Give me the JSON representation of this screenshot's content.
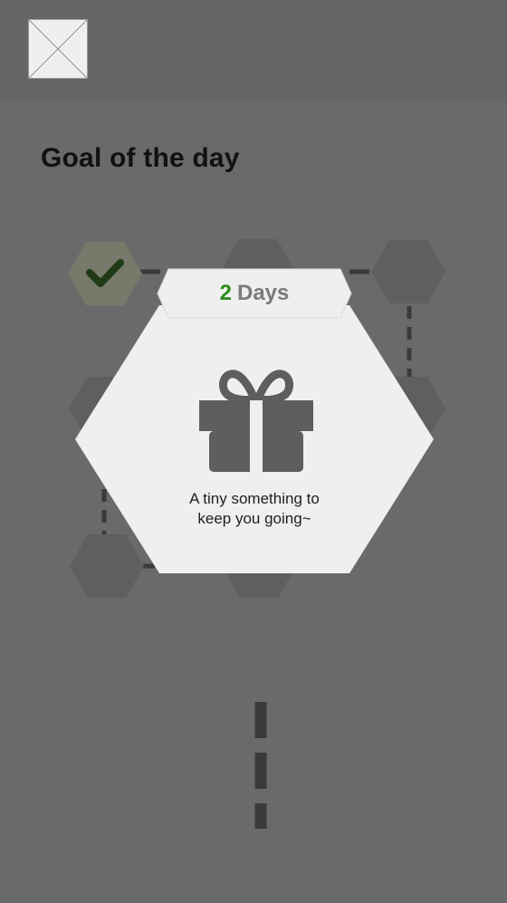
{
  "header": {
    "logo_icon": "image-placeholder-icon"
  },
  "page": {
    "title": "Goal of the day"
  },
  "board": {
    "completed_icon": "checkmark-icon",
    "completed_count": 1
  },
  "reward_popup": {
    "days_count": "2",
    "days_label": "Days",
    "gift_icon": "gift-icon",
    "message_line1": "A tiny something to",
    "message_line2": "keep you going~"
  },
  "colors": {
    "background": "#6a6a6a",
    "header": "#656565",
    "hex_default": "#5f5f5f",
    "hex_completed": "#77796a",
    "check": "#1f3a14",
    "days_number": "#2e8b1e",
    "popup_bg": "#efefef",
    "gift": "#5e5e5e"
  }
}
